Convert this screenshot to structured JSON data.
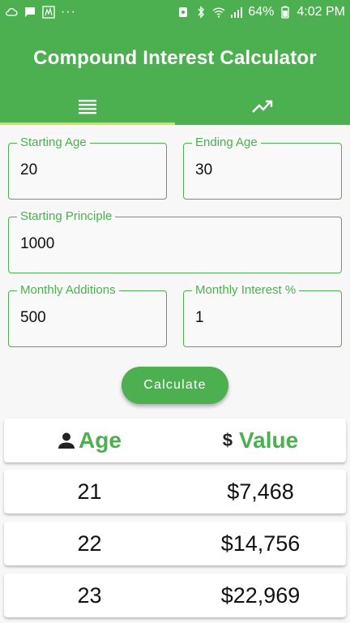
{
  "status_bar": {
    "dots": "···",
    "battery": "64%",
    "time": "4:02 PM"
  },
  "app": {
    "title": "Compound Interest Calculator",
    "tabs": [
      {
        "icon": "list-icon",
        "selected": true
      },
      {
        "icon": "trending-up-icon",
        "selected": false
      }
    ]
  },
  "form": {
    "starting_age": {
      "label": "Starting Age",
      "value": "20"
    },
    "ending_age": {
      "label": "Ending Age",
      "value": "30"
    },
    "starting_principle": {
      "label": "Starting Principle",
      "value": "1000"
    },
    "monthly_additions": {
      "label": "Monthly Additions",
      "value": "500"
    },
    "monthly_interest": {
      "label": "Monthly Interest %",
      "value": "1"
    },
    "calculate_label": "Calculate"
  },
  "table": {
    "headers": {
      "age": "Age",
      "value_symbol": "$",
      "value": "Value"
    },
    "rows": [
      {
        "age": "21",
        "value": "$7,468"
      },
      {
        "age": "22",
        "value": "$14,756"
      },
      {
        "age": "23",
        "value": "$22,969"
      }
    ]
  },
  "colors": {
    "primary": "#4caf50",
    "tab_indicator": "#d4e157"
  }
}
